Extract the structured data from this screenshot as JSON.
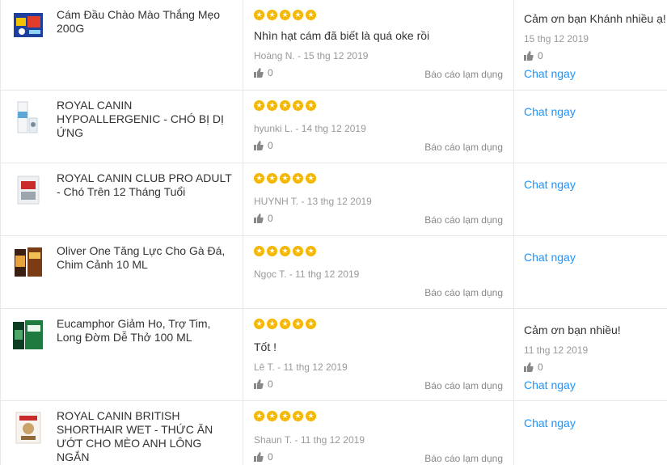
{
  "rows": [
    {
      "product_name": "Cám Đầu Chào Mào Thắng Mẹo 200G",
      "review_text": "Nhìn hạt cám đã biết là quá oke rồi",
      "meta": "Hoàng N. - 15 thg 12 2019",
      "likes": "0",
      "report": "Báo cáo lạm dụng",
      "reply_text": "Cảm ơn bạn Khánh nhiều ạ!",
      "reply_date": "15 thg 12 2019",
      "reply_likes": "0",
      "chat": "Chat ngay",
      "rating": 5
    },
    {
      "product_name": "ROYAL CANIN HYPOALLERGENIC - CHÓ BỊ DỊ ỨNG",
      "review_text": "",
      "meta": "hyunki L. - 14 thg 12 2019",
      "likes": "0",
      "report": "Báo cáo lạm dụng",
      "chat": "Chat ngay",
      "rating": 5
    },
    {
      "product_name": "ROYAL CANIN CLUB PRO ADULT - Chó Trên 12 Tháng Tuổi",
      "review_text": "",
      "meta": "HUYNH T. - 13 thg 12 2019",
      "likes": "0",
      "report": "Báo cáo lạm dụng",
      "chat": "Chat ngay",
      "rating": 5
    },
    {
      "product_name": "Oliver One Tăng Lực Cho Gà Đá, Chim Cảnh 10 ML",
      "review_text": "",
      "meta": "Ngọc T. - 11 thg 12 2019",
      "likes": "",
      "report": "Báo cáo lạm dụng",
      "chat": "Chat ngay",
      "rating": 5
    },
    {
      "product_name": "Eucamphor Giảm Ho, Trợ Tim, Long Đờm Dễ Thở 100 ML",
      "review_text": "Tốt !",
      "meta": "Lê T. - 11 thg 12 2019",
      "likes": "0",
      "report": "Báo cáo lạm dụng",
      "reply_text": "Cảm ơn bạn nhiều!",
      "reply_date": "11 thg 12 2019",
      "reply_likes": "0",
      "chat": "Chat ngay",
      "rating": 5
    },
    {
      "product_name": "ROYAL CANIN BRITISH SHORTHAIR WET - THỨC ĂN ƯỚT CHO MÈO ANH LÔNG NGẮN",
      "review_text": "",
      "meta": "Shaun T. - 11 thg 12 2019",
      "likes": "0",
      "report": "Báo cáo lạm dụng",
      "chat": "Chat ngay",
      "rating": 5
    }
  ],
  "colors": {
    "star": "#f5b700",
    "link": "#1a94ff",
    "muted": "#999999",
    "border": "#e8e8e8"
  },
  "icons": {
    "like": "thumbs-up-icon",
    "star": "star-icon"
  }
}
